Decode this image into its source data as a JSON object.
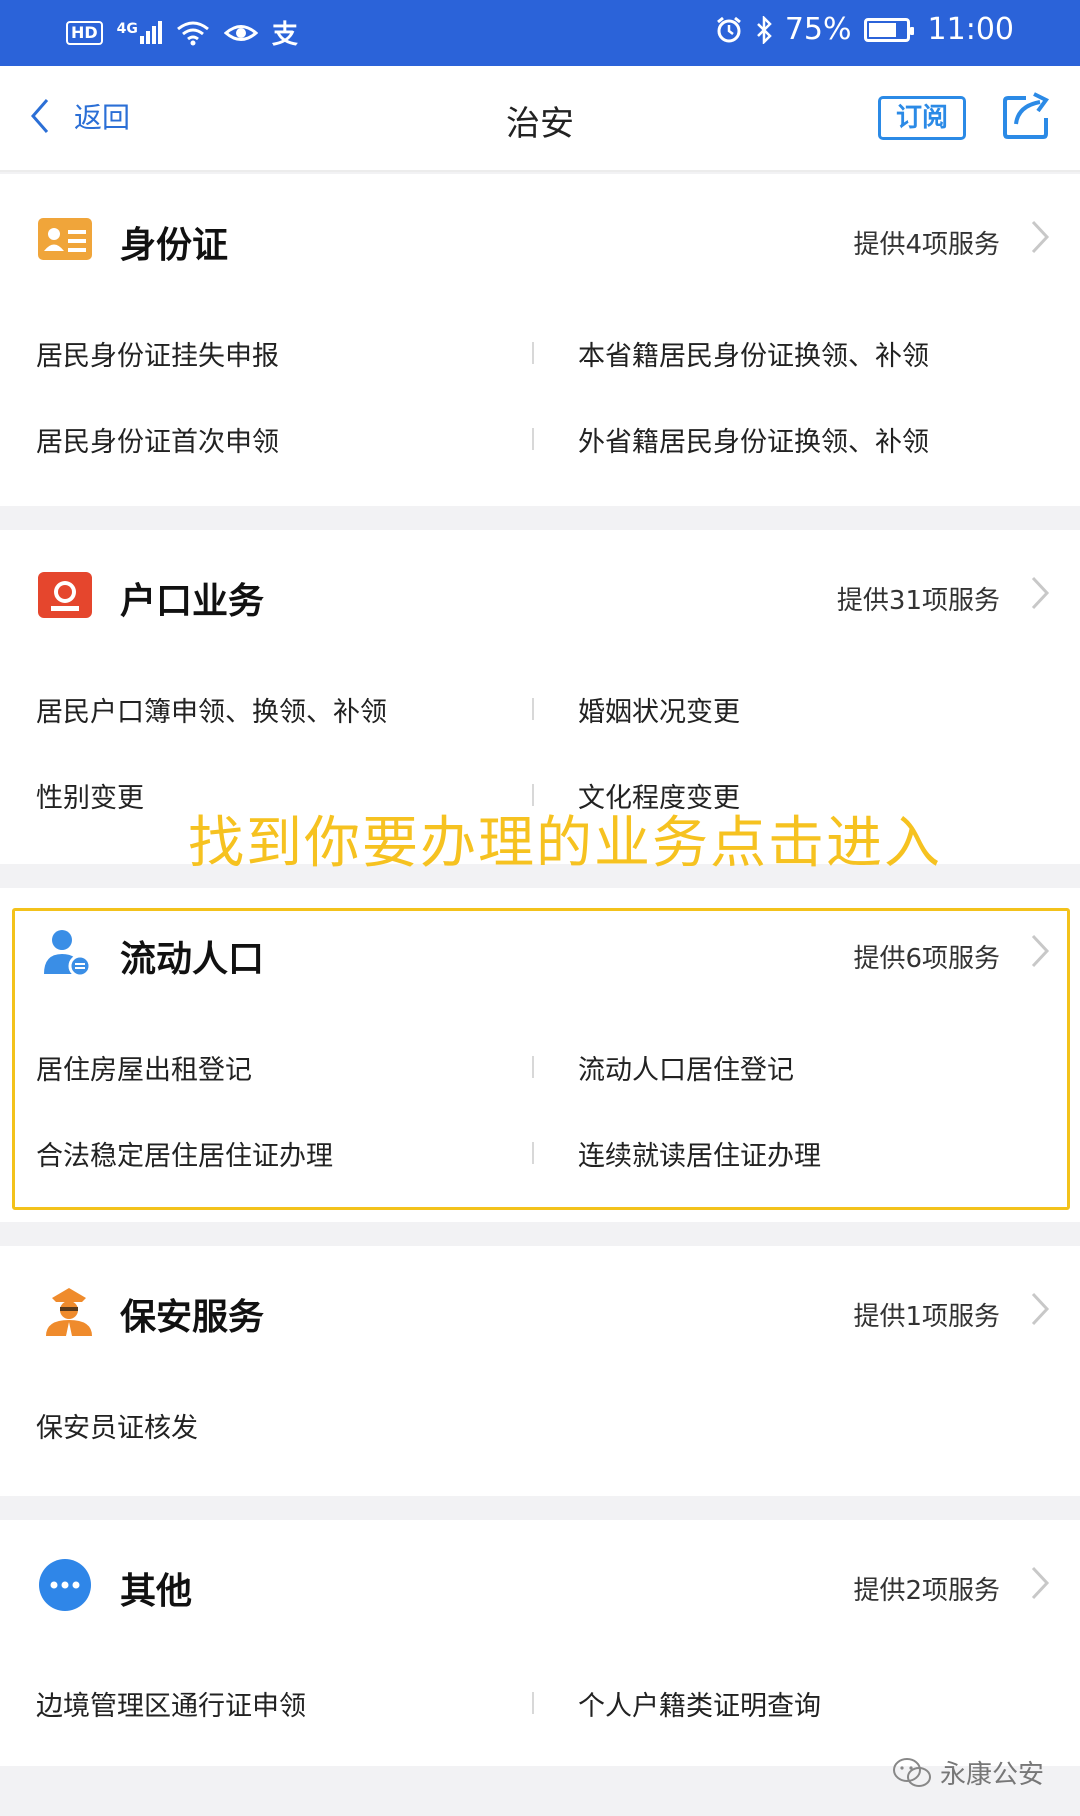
{
  "status_bar": {
    "left_icons": [
      "HD",
      "4G",
      "signal",
      "wifi",
      "eye",
      "alipay"
    ],
    "battery_percent": "75%",
    "battery_level": 0.75,
    "time": "11:00"
  },
  "nav": {
    "back_label": "返回",
    "title": "治安",
    "subscribe_label": "订阅"
  },
  "sections": [
    {
      "title": "身份证",
      "count": "提供4项服务",
      "icon": "id-card-icon",
      "items": [
        "居民身份证挂失申报",
        "本省籍居民身份证换领、补领",
        "居民身份证首次申领",
        "外省籍居民身份证换领、补领"
      ]
    },
    {
      "title": "户口业务",
      "count": "提供31项服务",
      "icon": "household-register-icon",
      "items": [
        "居民户口簿申领、换领、补领",
        "婚姻状况变更",
        "性别变更",
        "文化程度变更"
      ]
    },
    {
      "title": "流动人口",
      "count": "提供6项服务",
      "icon": "floating-population-icon",
      "items": [
        "居住房屋出租登记",
        "流动人口居住登记",
        "合法稳定居住居住证办理",
        "连续就读居住证办理"
      ]
    },
    {
      "title": "保安服务",
      "count": "提供1项服务",
      "icon": "security-guard-icon",
      "items": [
        "保安员证核发"
      ]
    },
    {
      "title": "其他",
      "count": "提供2项服务",
      "icon": "more-icon",
      "items": [
        "边境管理区通行证申领",
        "个人户籍类证明查询"
      ]
    }
  ],
  "annotation": "找到你要办理的业务点击进入",
  "watermark": "永康公安",
  "colors": {
    "status_bar": "#2b63d9",
    "link_blue": "#2b6fd6",
    "subscribe_blue": "#2b8ae6",
    "annotation_yellow": "#f6c220",
    "id_card_orange": "#f0a53a",
    "household_red": "#e5462d",
    "floating_blue": "#3a8ee6",
    "guard_orange": "#ef8b2c",
    "more_blue": "#2f86e8"
  }
}
